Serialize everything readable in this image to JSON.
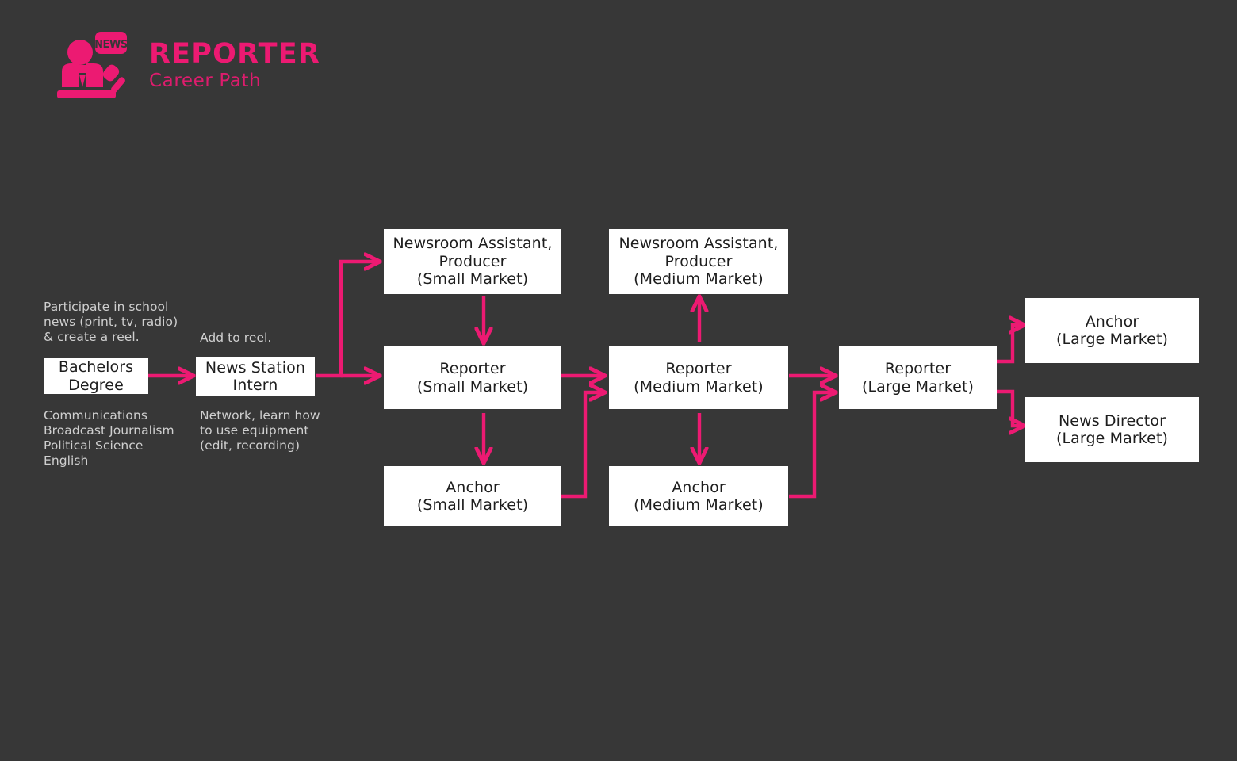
{
  "page": {
    "background_color": "#373737",
    "accent_color": "#ec1a72",
    "node_bg_color": "#ffffff",
    "annotation_color": "#cfcfcf"
  },
  "header": {
    "title": "REPORTER",
    "subtitle": "Career Path",
    "logo_icon": "news-anchor-icon",
    "logo_badge_text": "NEWS"
  },
  "annotations": {
    "school_news": "Participate in school\nnews (print, tv, radio)\n& create a reel.",
    "degree_majors": "Communications\nBroadcast Journalism\nPolitical Science\nEnglish",
    "add_to_reel": "Add to reel.",
    "intern_notes": "Network, learn how\nto use equipment\n(edit, recording)"
  },
  "nodes": [
    {
      "id": "bachelors-degree",
      "label": "Bachelors\nDegree"
    },
    {
      "id": "news-station-intern",
      "label": "News Station\nIntern"
    },
    {
      "id": "newsroom-assistant-small",
      "label": "Newsroom Assistant,\nProducer\n(Small Market)"
    },
    {
      "id": "reporter-small",
      "label": "Reporter\n(Small Market)"
    },
    {
      "id": "anchor-small",
      "label": "Anchor\n(Small Market)"
    },
    {
      "id": "newsroom-assistant-medium",
      "label": "Newsroom Assistant,\nProducer\n(Medium Market)"
    },
    {
      "id": "reporter-medium",
      "label": "Reporter\n(Medium Market)"
    },
    {
      "id": "anchor-medium",
      "label": "Anchor\n(Medium Market)"
    },
    {
      "id": "reporter-large",
      "label": "Reporter\n(Large Market)"
    },
    {
      "id": "anchor-large",
      "label": "Anchor\n(Large Market)"
    },
    {
      "id": "news-director-large",
      "label": "News Director\n(Large Market)"
    }
  ],
  "edges": [
    {
      "from": "bachelors-degree",
      "to": "news-station-intern"
    },
    {
      "from": "news-station-intern",
      "to": "newsroom-assistant-small"
    },
    {
      "from": "news-station-intern",
      "to": "reporter-small"
    },
    {
      "from": "newsroom-assistant-small",
      "to": "reporter-small"
    },
    {
      "from": "reporter-small",
      "to": "anchor-small"
    },
    {
      "from": "reporter-small",
      "to": "reporter-medium"
    },
    {
      "from": "anchor-small",
      "to": "reporter-medium"
    },
    {
      "from": "reporter-medium",
      "to": "newsroom-assistant-medium"
    },
    {
      "from": "reporter-medium",
      "to": "anchor-medium"
    },
    {
      "from": "reporter-medium",
      "to": "reporter-large"
    },
    {
      "from": "anchor-medium",
      "to": "reporter-large"
    },
    {
      "from": "reporter-large",
      "to": "anchor-large"
    },
    {
      "from": "reporter-large",
      "to": "news-director-large"
    }
  ]
}
